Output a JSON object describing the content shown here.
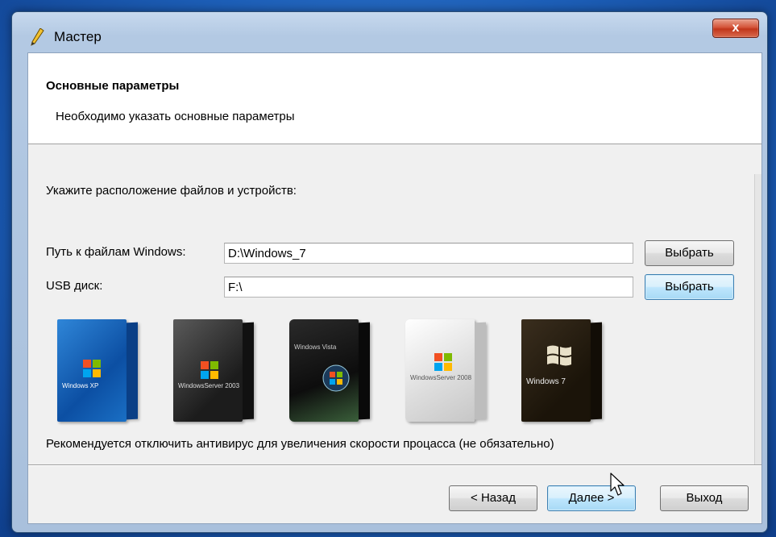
{
  "window": {
    "title": "Мастер",
    "close_symbol": "x"
  },
  "header": {
    "title": "Основные параметры",
    "subtitle": "Необходимо указать основные параметры"
  },
  "main": {
    "prompt": "Укажите расположение файлов и устройств:",
    "windows_path": {
      "label": "Путь к файлам Windows:",
      "value": "D:\\Windows_7",
      "button": "Выбрать"
    },
    "usb_disk": {
      "label": "USB диск:",
      "value": "F:\\",
      "button": "Выбрать"
    },
    "box_images": [
      {
        "name": "windows-xp-box",
        "caption": "Windows XP"
      },
      {
        "name": "windows-server-2003-box",
        "caption": "WindowsServer 2003"
      },
      {
        "name": "windows-vista-box",
        "caption": "Windows Vista"
      },
      {
        "name": "windows-server-2008-box",
        "caption": "WindowsServer 2008"
      },
      {
        "name": "windows-7-box",
        "caption": "Windows 7"
      }
    ],
    "note": "Рекомендуется отключить антивирус для увеличения скорости процасса (не обязательно)"
  },
  "footer": {
    "back": "< Назад",
    "next": "Далее >",
    "exit": "Выход"
  },
  "colors": {
    "desktop": "#1d5fb8",
    "close_button": "#c1361b",
    "focused_button": "#bee6fd"
  },
  "icons": [
    "pencil-icon",
    "close-icon",
    "mouse-cursor-icon",
    "windows-flag-icon"
  ]
}
